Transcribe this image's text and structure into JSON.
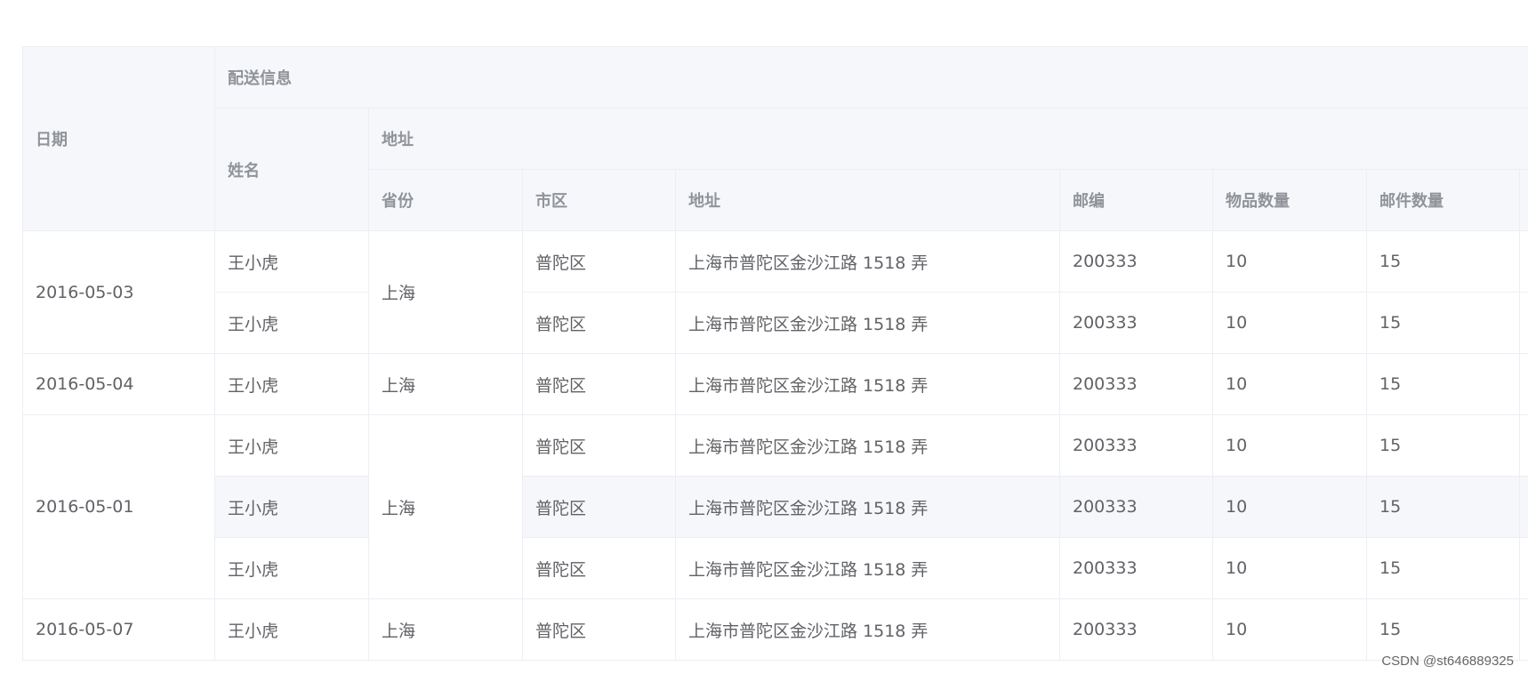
{
  "table": {
    "headers": {
      "date": "日期",
      "delivery_info": "配送信息",
      "name": "姓名",
      "address_group": "地址",
      "province": "省份",
      "city": "市区",
      "address": "地址",
      "zip": "邮编",
      "item_count": "物品数量",
      "mail_count": "邮件数量"
    },
    "rows": [
      {
        "date": "2016-05-03",
        "name": "王小虎",
        "province": "上海",
        "city": "普陀区",
        "address": "上海市普陀区金沙江路 1518 弄",
        "zip": "200333",
        "item_count": "10",
        "mail_count": "15"
      },
      {
        "date": "2016-05-03",
        "name": "王小虎",
        "province": "上海",
        "city": "普陀区",
        "address": "上海市普陀区金沙江路 1518 弄",
        "zip": "200333",
        "item_count": "10",
        "mail_count": "15"
      },
      {
        "date": "2016-05-04",
        "name": "王小虎",
        "province": "上海",
        "city": "普陀区",
        "address": "上海市普陀区金沙江路 1518 弄",
        "zip": "200333",
        "item_count": "10",
        "mail_count": "15"
      },
      {
        "date": "2016-05-01",
        "name": "王小虎",
        "province": "上海",
        "city": "普陀区",
        "address": "上海市普陀区金沙江路 1518 弄",
        "zip": "200333",
        "item_count": "10",
        "mail_count": "15"
      },
      {
        "date": "2016-05-01",
        "name": "王小虎",
        "province": "上海",
        "city": "普陀区",
        "address": "上海市普陀区金沙江路 1518 弄",
        "zip": "200333",
        "item_count": "10",
        "mail_count": "15"
      },
      {
        "date": "2016-05-01",
        "name": "王小虎",
        "province": "上海",
        "city": "普陀区",
        "address": "上海市普陀区金沙江路 1518 弄",
        "zip": "200333",
        "item_count": "10",
        "mail_count": "15"
      },
      {
        "date": "2016-05-07",
        "name": "王小虎",
        "province": "上海",
        "city": "普陀区",
        "address": "上海市普陀区金沙江路 1518 弄",
        "zip": "200333",
        "item_count": "10",
        "mail_count": "15"
      }
    ]
  },
  "watermark": "CSDN @st646889325"
}
